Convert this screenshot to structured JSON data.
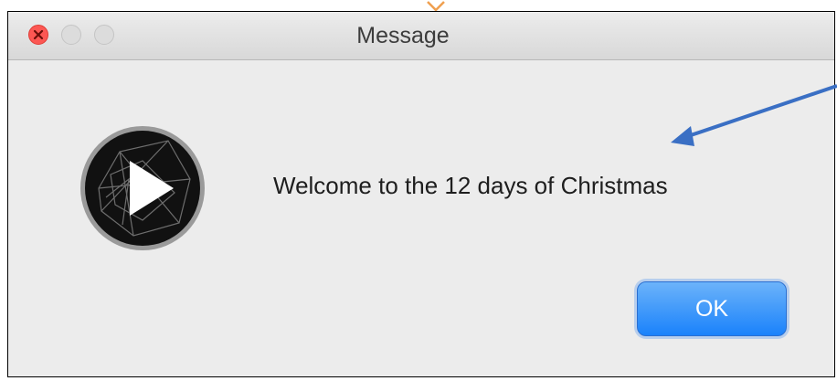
{
  "window": {
    "title": "Message"
  },
  "icons": {
    "close": "close-icon",
    "minimize": "minimize-icon",
    "maximize": "maximize-icon",
    "app": "play-icon"
  },
  "dialog": {
    "message": "Welcome to the 12 days of Christmas",
    "ok_label": "OK"
  },
  "colors": {
    "ok_button": "#1a82fb",
    "close_button": "#fc5753",
    "annotation_arrow": "#3a6fc4",
    "annotation_marker": "#f0a050"
  }
}
